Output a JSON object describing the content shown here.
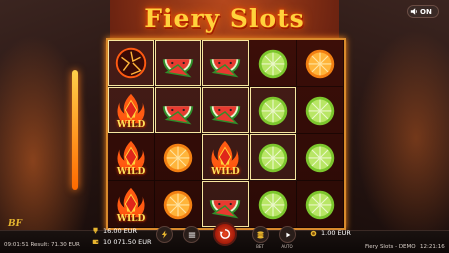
{
  "game": {
    "title": "Fiery Slots",
    "sound_toggle": {
      "label": "ON",
      "icon": "speaker-icon"
    }
  },
  "reels": [
    [
      "firestone",
      "watermelon",
      "watermelon",
      "lime",
      "orange"
    ],
    [
      "wild",
      "watermelon",
      "watermelon",
      "lime",
      "lime"
    ],
    [
      "wild",
      "orange",
      "wild",
      "lime",
      "lime"
    ],
    [
      "wild",
      "orange",
      "watermelon",
      "lime",
      "lime"
    ]
  ],
  "highlighted_cells": [
    [
      0,
      0
    ],
    [
      0,
      1
    ],
    [
      0,
      2
    ],
    [
      1,
      0
    ],
    [
      1,
      1
    ],
    [
      1,
      2
    ],
    [
      1,
      3
    ],
    [
      2,
      2
    ],
    [
      2,
      3
    ],
    [
      3,
      2
    ]
  ],
  "symbols": {
    "wild_label": "WILD"
  },
  "footer": {
    "brand": "BF",
    "clock_result": "09:01:51  Result: 71.30 EUR",
    "title_right": "Fiery Slots - DEMO",
    "time_right": "12:21:16",
    "win": "16.00 EUR",
    "balance": "10 071.50 EUR",
    "bet": "1.00 EUR",
    "bet_caption": "BET",
    "auto_caption": "AUTO"
  },
  "colors": {
    "accent": "#ffd23c",
    "frame": "#d98a2c",
    "spin": "#e8451e"
  }
}
